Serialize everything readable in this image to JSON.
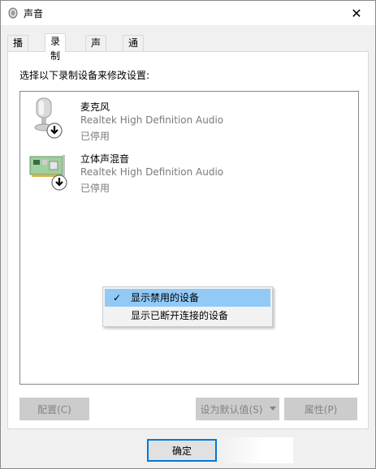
{
  "window": {
    "title": "声音",
    "close_glyph": "✕"
  },
  "tabs": [
    {
      "label": "播放"
    },
    {
      "label": "录制"
    },
    {
      "label": "声音"
    },
    {
      "label": "通信"
    }
  ],
  "panel": {
    "instruction": "选择以下录制设备来修改设置:"
  },
  "devices": [
    {
      "name": "麦克风",
      "description": "Realtek High Definition Audio",
      "status": "已停用",
      "icon": "microphone-icon"
    },
    {
      "name": "立体声混音",
      "description": "Realtek High Definition Audio",
      "status": "已停用",
      "icon": "sound-card-icon"
    }
  ],
  "context_menu": {
    "items": [
      {
        "label": "显示禁用的设备",
        "checked": true
      },
      {
        "label": "显示已断开连接的设备",
        "checked": false
      }
    ],
    "check_glyph": "✓"
  },
  "buttons": {
    "configure": "配置(C)",
    "set_default": "设为默认值(S)",
    "properties": "属性(P)",
    "ok": "确定"
  },
  "colors": {
    "focus": "#0078d7",
    "menu_highlight": "#91c9f7",
    "disabled_text": "#838383"
  }
}
